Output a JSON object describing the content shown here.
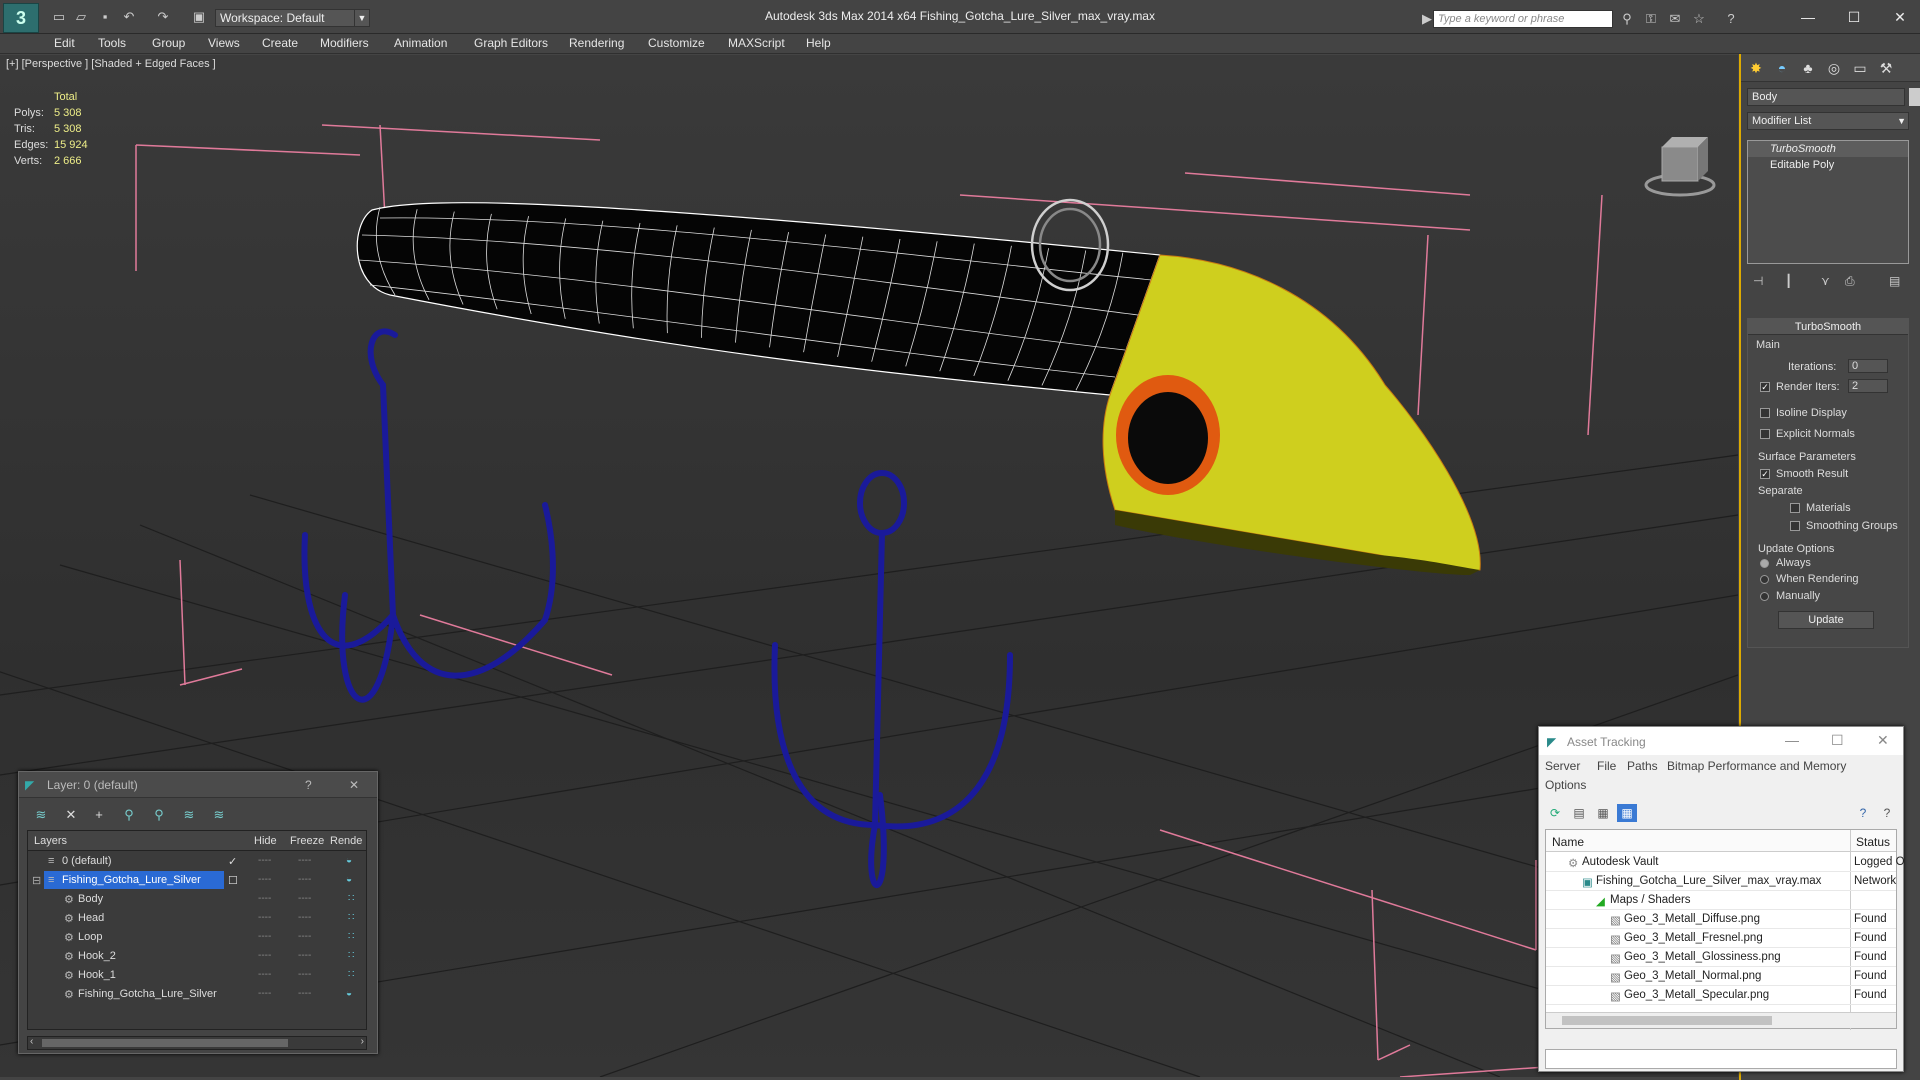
{
  "app": {
    "workspace": "Workspace: Default",
    "title": "Autodesk 3ds Max  2014 x64      Fishing_Gotcha_Lure_Silver_max_vray.max",
    "search_placeholder": "Type a keyword or phrase"
  },
  "menu": [
    "Edit",
    "Tools",
    "Group",
    "Views",
    "Create",
    "Modifiers",
    "Animation",
    "Graph Editors",
    "Rendering",
    "Customize",
    "MAXScript",
    "Help"
  ],
  "viewport": {
    "label": "[+] [Perspective ] [Shaded + Edged Faces ]",
    "stats": {
      "header": "Total",
      "polys_label": "Polys:",
      "polys": "5 308",
      "tris_label": "Tris:",
      "tris": "5 308",
      "edges_label": "Edges:",
      "edges": "15 924",
      "verts_label": "Verts:",
      "verts": "2 666"
    }
  },
  "command_panel": {
    "object_name": "Body",
    "modifier_list": "Modifier List",
    "stack": [
      "TurboSmooth",
      "Editable Poly"
    ],
    "rollout_title": "TurboSmooth",
    "main_label": "Main",
    "iterations_label": "Iterations:",
    "iterations": "0",
    "render_iters_label": "Render Iters:",
    "render_iters": "2",
    "isoline": "Isoline Display",
    "explicit_normals": "Explicit Normals",
    "surface_params": "Surface Parameters",
    "smooth_result": "Smooth Result",
    "separate": "Separate",
    "materials": "Materials",
    "smoothing_groups": "Smoothing Groups",
    "update_options": "Update Options",
    "always": "Always",
    "when_rendering": "When Rendering",
    "manually": "Manually",
    "update_btn": "Update"
  },
  "layer_window": {
    "title": "Layer: 0 (default)",
    "help": "?",
    "columns": {
      "layers": "Layers",
      "hide": "Hide",
      "freeze": "Freeze",
      "render": "Rende"
    },
    "rows": [
      {
        "name": "0 (default)"
      },
      {
        "name": "Fishing_Gotcha_Lure_Silver"
      },
      {
        "name": "Body"
      },
      {
        "name": "Head"
      },
      {
        "name": "Loop"
      },
      {
        "name": "Hook_2"
      },
      {
        "name": "Hook_1"
      },
      {
        "name": "Fishing_Gotcha_Lure_Silver"
      }
    ],
    "dash": "----"
  },
  "asset_window": {
    "title": "Asset Tracking",
    "menu": [
      "Server",
      "File",
      "Paths",
      "Bitmap Performance and Memory",
      "Options"
    ],
    "columns": {
      "name": "Name",
      "status": "Status"
    },
    "rows": [
      {
        "name": "Autodesk Vault",
        "status": "Logged O"
      },
      {
        "name": "Fishing_Gotcha_Lure_Silver_max_vray.max",
        "status": "Network"
      },
      {
        "name": "Maps / Shaders",
        "status": ""
      },
      {
        "name": "Geo_3_Metall_Diffuse.png",
        "status": "Found"
      },
      {
        "name": "Geo_3_Metall_Fresnel.png",
        "status": "Found"
      },
      {
        "name": "Geo_3_Metall_Glossiness.png",
        "status": "Found"
      },
      {
        "name": "Geo_3_Metall_Normal.png",
        "status": "Found"
      },
      {
        "name": "Geo_3_Metall_Specular.png",
        "status": "Found"
      }
    ]
  },
  "colors": {
    "accent": "#ddaa00",
    "bbox": "#e07a9a",
    "wire_blue": "#1a1a9a",
    "head_yellow": "#d4d420",
    "eye_orange": "#e05a10"
  }
}
